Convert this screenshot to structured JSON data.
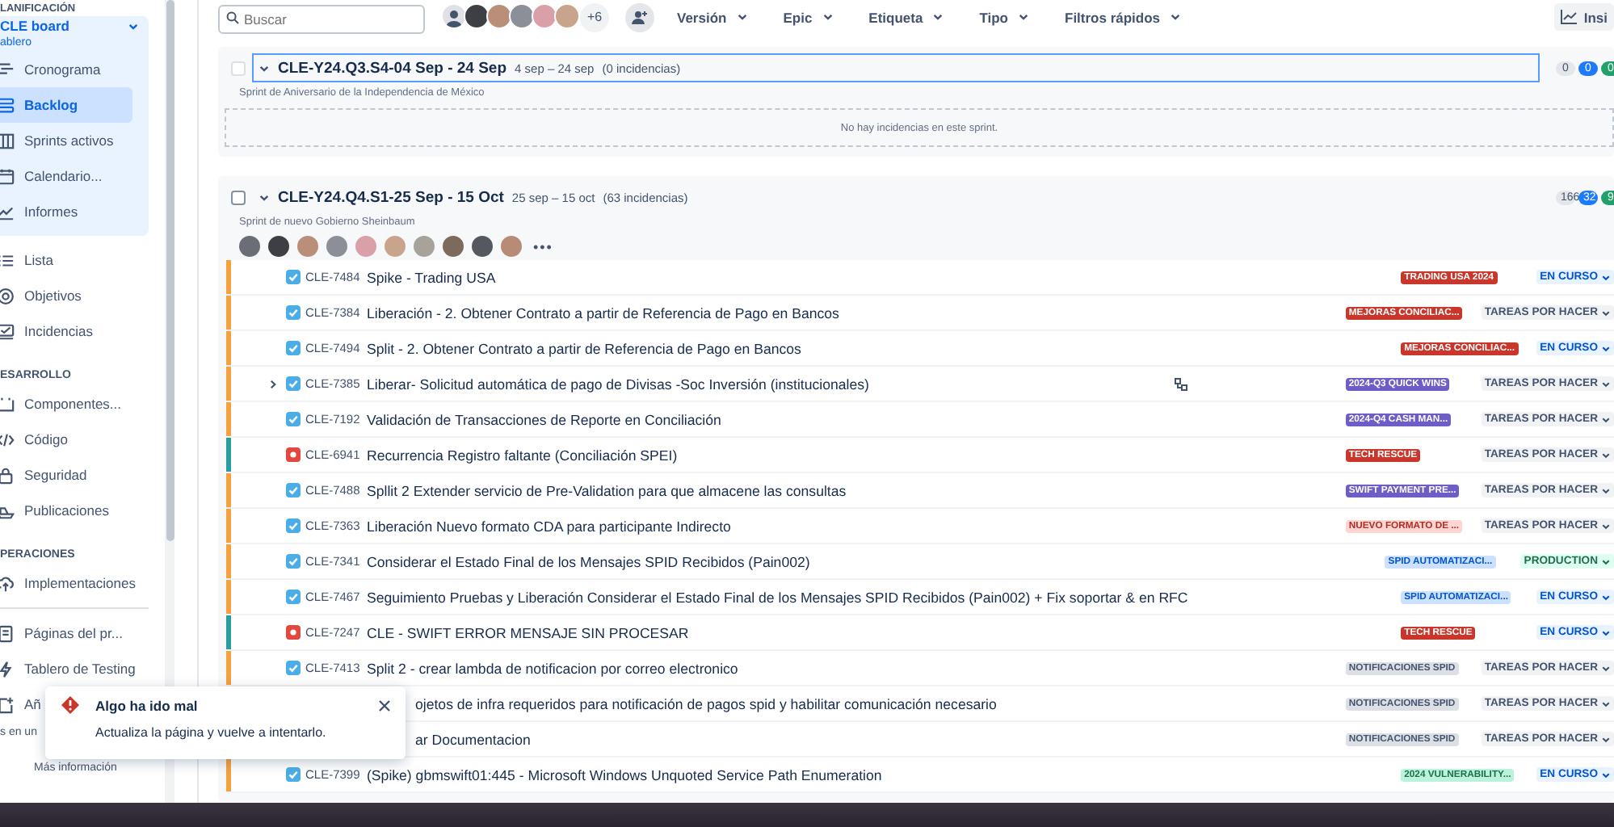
{
  "sidebar": {
    "sections": [
      {
        "title": "LANIFICACIÓN",
        "board": {
          "name": "CLE board",
          "subtitle": "ablero",
          "items": [
            {
              "label": "Cronograma",
              "kind": "timeline",
              "selected": false
            },
            {
              "label": "Backlog",
              "kind": "backlog",
              "selected": true
            },
            {
              "label": "Sprints activos",
              "kind": "board",
              "selected": false
            },
            {
              "label": "Calendario...",
              "kind": "calendar",
              "selected": false
            },
            {
              "label": "Informes",
              "kind": "chart",
              "selected": false
            }
          ]
        },
        "items": [
          {
            "label": "Lista",
            "kind": "list",
            "selected": false
          },
          {
            "label": "Objetivos",
            "kind": "target",
            "selected": false
          },
          {
            "label": "Incidencias",
            "kind": "issues",
            "selected": false
          }
        ]
      },
      {
        "title": "ESARROLLO",
        "items": [
          {
            "label": "Componentes...",
            "kind": "component",
            "selected": false
          },
          {
            "label": "Código",
            "kind": "code",
            "selected": false
          },
          {
            "label": "Seguridad",
            "kind": "lock",
            "selected": false
          },
          {
            "label": "Publicaciones",
            "kind": "ship",
            "selected": false
          }
        ]
      },
      {
        "title": "PERACIONES",
        "items": [
          {
            "label": "Implementaciones",
            "kind": "cloud",
            "selected": false
          }
        ]
      }
    ],
    "footer_items": [
      {
        "label": "Páginas del pr...",
        "kind": "page",
        "selected": false
      },
      {
        "label": "Tablero de Testing",
        "kind": "bolt",
        "selected": false
      },
      {
        "label": "Añ",
        "kind": "add",
        "selected": false
      }
    ],
    "footer_note": "s en un",
    "more_link": "Más información"
  },
  "toolbar": {
    "search": {
      "placeholder": "Buscar"
    },
    "avatar_overflow": "+6",
    "filters": [
      "Versión",
      "Epic",
      "Etiqueta",
      "Tipo",
      "Filtros rápidos"
    ],
    "insights_button": "Insi"
  },
  "sprints": [
    {
      "name": "CLE-Y24.Q3.S4-04 Sep - 24 Sep",
      "dates": "4 sep – 24 sep",
      "count": "(0 incidencias)",
      "focused": true,
      "description": "Sprint de Aniversario de la Independencia de México",
      "counts": [
        {
          "value": "0",
          "kind": "todo"
        },
        {
          "value": "0",
          "kind": "inprogress"
        },
        {
          "value": "0",
          "kind": "done"
        }
      ],
      "empty_message": "No hay incidencias en este sprint.",
      "checked": false,
      "disabled": true
    },
    {
      "name": "CLE-Y24.Q4.S1-25 Sep - 15 Oct",
      "dates": "25 sep – 15 oct",
      "count": "(63 incidencias)",
      "focused": false,
      "description": "Sprint de nuevo Gobierno Sheinbaum",
      "counts": [
        {
          "value": "166",
          "kind": "todo"
        },
        {
          "value": "32",
          "kind": "inprogress"
        },
        {
          "value": "9",
          "kind": "done"
        }
      ],
      "checked": false,
      "disabled": false,
      "more": "•••",
      "issues": [
        {
          "key": "CLE-7484",
          "kind": "task",
          "summary": "Spike - Trading USA",
          "has_subtasks": false,
          "color": "#f5a142",
          "epic": {
            "label": "TRADING USA 2024",
            "color": "#c9372c"
          },
          "status": {
            "label": "EN CURSO",
            "kind": "inprogress"
          }
        },
        {
          "key": "CLE-7384",
          "kind": "task",
          "summary": "Liberación - 2. Obtener Contrato a partir de Referencia de Pago en Bancos",
          "has_subtasks": false,
          "color": "#f5a142",
          "epic": {
            "label": "MEJORAS CONCILIAC...",
            "color": "#c9372c"
          },
          "status": {
            "label": "TAREAS POR HACER",
            "kind": "todo"
          }
        },
        {
          "key": "CLE-7494",
          "kind": "task",
          "summary": "Split - 2. Obtener Contrato a partir de Referencia de Pago en Bancos",
          "has_subtasks": false,
          "color": "#f5a142",
          "epic": {
            "label": "MEJORAS CONCILIAC...",
            "color": "#c9372c"
          },
          "status": {
            "label": "EN CURSO",
            "kind": "inprogress"
          }
        },
        {
          "key": "CLE-7385",
          "kind": "task",
          "summary": "Liberar- Solicitud automática de pago de Divisas -Soc Inversión (institucionales)",
          "has_subtasks": true,
          "color": "#f5a142",
          "epic": {
            "label": "2024-Q3 QUICK WINS",
            "color": "#6e5dc6"
          },
          "status": {
            "label": "TAREAS POR HACER",
            "kind": "todo"
          }
        },
        {
          "key": "CLE-7192",
          "kind": "task",
          "summary": "Validación de Transacciones de Reporte en Conciliación",
          "has_subtasks": false,
          "color": "#f5a142",
          "epic": {
            "label": "2024-Q4 CASH MAN...",
            "color": "#6e5dc6"
          },
          "status": {
            "label": "TAREAS POR HACER",
            "kind": "todo"
          }
        },
        {
          "key": "CLE-6941",
          "kind": "bug",
          "summary": "Recurrencia Registro faltante (Conciliación SPEI)",
          "has_subtasks": false,
          "color": "#2a9d9f",
          "epic": {
            "label": "TECH RESCUE",
            "color": "#c9372c"
          },
          "status": {
            "label": "TAREAS POR HACER",
            "kind": "todo"
          }
        },
        {
          "key": "CLE-7488",
          "kind": "task",
          "summary": "Spllit 2 Extender servicio de Pre-Validation para que almacene las consultas",
          "has_subtasks": false,
          "color": "#f5a142",
          "epic": {
            "label": "SWIFT PAYMENT PRE...",
            "color": "#6e5dc6"
          },
          "status": {
            "label": "TAREAS POR HACER",
            "kind": "todo"
          }
        },
        {
          "key": "CLE-7363",
          "kind": "task",
          "summary": "Liberación Nuevo formato CDA para participante Indirecto",
          "has_subtasks": false,
          "color": "#f5a142",
          "epic": {
            "label": "NUEVO FORMATO DE ...",
            "color": "#ffd5d2"
          },
          "status": {
            "label": "TAREAS POR HACER",
            "kind": "todo"
          }
        },
        {
          "key": "CLE-7341",
          "kind": "task",
          "summary": "Considerar el Estado Final de los Mensajes SPID Recibidos (Pain002)",
          "has_subtasks": false,
          "color": "#f5a142",
          "epic": {
            "label": "SPID AUTOMATIZACI...",
            "color": "#cce0ff"
          },
          "status": {
            "label": "PRODUCTION",
            "kind": "done"
          }
        },
        {
          "key": "CLE-7467",
          "kind": "task",
          "summary": "Seguimiento Pruebas y Liberación Considerar el Estado Final de los Mensajes SPID Recibidos (Pain002) + Fix soportar & en RFC",
          "has_subtasks": false,
          "color": "#f5a142",
          "epic": {
            "label": "SPID AUTOMATIZACI...",
            "color": "#cce0ff"
          },
          "status": {
            "label": "EN CURSO",
            "kind": "inprogress"
          }
        },
        {
          "key": "CLE-7247",
          "kind": "bug",
          "summary": "CLE - SWIFT ERROR MENSAJE SIN PROCESAR",
          "has_subtasks": false,
          "color": "#2a9d9f",
          "epic": {
            "label": "TECH RESCUE",
            "color": "#c9372c"
          },
          "status": {
            "label": "EN CURSO",
            "kind": "inprogress"
          }
        },
        {
          "key": "CLE-7413",
          "kind": "task",
          "summary": "Split 2 - crear lambda de notificacion por correo electronico",
          "has_subtasks": false,
          "color": "#f5a142",
          "epic": {
            "label": "NOTIFICACIONES SPID",
            "color": "#dcdfe4"
          },
          "status": {
            "label": "TAREAS POR HACER",
            "kind": "todo"
          }
        },
        {
          "summary": "ojetos de infra requeridos para notificación de pagos spid y habilitar comunicación necesario",
          "has_subtasks": false,
          "epic": {
            "label": "NOTIFICACIONES SPID",
            "color": "#dcdfe4"
          },
          "status": {
            "label": "TAREAS POR HACER",
            "kind": "todo"
          }
        },
        {
          "summary": "ar Documentacion",
          "has_subtasks": false,
          "epic": {
            "label": "NOTIFICACIONES SPID",
            "color": "#dcdfe4"
          },
          "status": {
            "label": "TAREAS POR HACER",
            "kind": "todo"
          }
        },
        {
          "key": "CLE-7399",
          "kind": "task",
          "summary": "(Spike) gbmswift01:445 - Microsoft Windows Unquoted Service Path Enumeration",
          "has_subtasks": false,
          "color": "#f5a142",
          "epic": {
            "label": "2024 VULNERABILITY...",
            "color": "#baf3db"
          },
          "status": {
            "label": "EN CURSO",
            "kind": "inprogress"
          }
        }
      ]
    }
  ],
  "toast": {
    "title": "Algo ha ido mal",
    "message": "Actualiza la página y vuelve a intentarlo."
  }
}
